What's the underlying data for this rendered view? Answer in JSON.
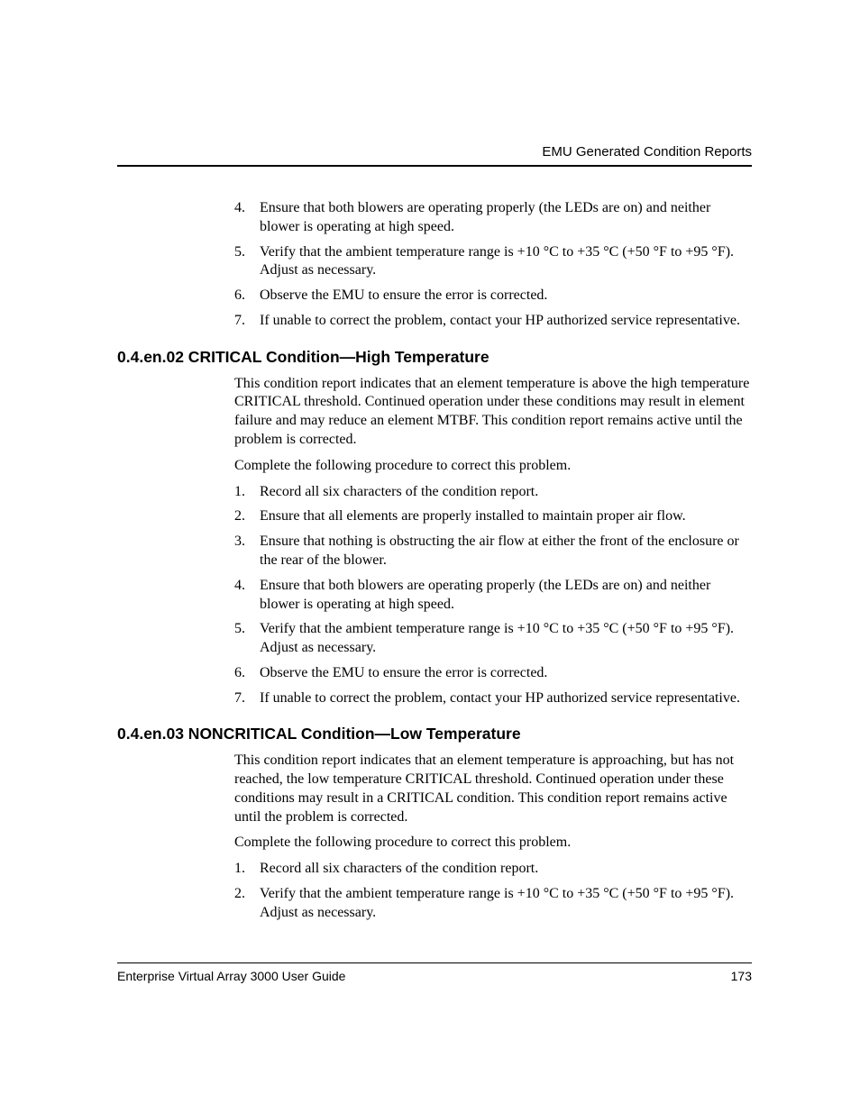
{
  "header": {
    "title": "EMU Generated Condition Reports"
  },
  "footer": {
    "doc_title": "Enterprise Virtual Array 3000 User Guide",
    "page_number": "173"
  },
  "top_list": {
    "items": [
      {
        "n": "4.",
        "t": "Ensure that both blowers are operating properly (the LEDs are on) and neither blower is operating at high speed."
      },
      {
        "n": "5.",
        "t": "Verify that the ambient temperature range is +10 °C to +35 °C (+50 °F to +95 °F). Adjust as necessary."
      },
      {
        "n": "6.",
        "t": "Observe the EMU to ensure the error is corrected."
      },
      {
        "n": "7.",
        "t": "If unable to correct the problem, contact your HP authorized service representative."
      }
    ]
  },
  "section1": {
    "heading": "0.4.en.02 CRITICAL Condition—High Temperature",
    "p1": "This condition report indicates that an element temperature is above the high temperature CRITICAL threshold. Continued operation under these conditions may result in element failure and may reduce an element MTBF. This condition report remains active until the problem is corrected.",
    "p2": "Complete the following procedure to correct this problem.",
    "items": [
      {
        "n": "1.",
        "t": "Record all six characters of the condition report."
      },
      {
        "n": "2.",
        "t": "Ensure that all elements are properly installed to maintain proper air flow."
      },
      {
        "n": "3.",
        "t": "Ensure that nothing is obstructing the air flow at either the front of the enclosure or the rear of the blower."
      },
      {
        "n": "4.",
        "t": "Ensure that both blowers are operating properly (the LEDs are on) and neither blower is operating at high speed."
      },
      {
        "n": "5.",
        "t": "Verify that the ambient temperature range is +10 °C to +35 °C (+50 °F to +95 °F). Adjust as necessary."
      },
      {
        "n": "6.",
        "t": "Observe the EMU to ensure the error is corrected."
      },
      {
        "n": "7.",
        "t": "If unable to correct the problem, contact your HP authorized service representative."
      }
    ]
  },
  "section2": {
    "heading": "0.4.en.03 NONCRITICAL Condition—Low Temperature",
    "p1": "This condition report indicates that an element temperature is approaching, but has not reached, the low temperature CRITICAL threshold. Continued operation under these conditions may result in a CRITICAL condition. This condition report remains active until the problem is corrected.",
    "p2": "Complete the following procedure to correct this problem.",
    "items": [
      {
        "n": "1.",
        "t": "Record all six characters of the condition report."
      },
      {
        "n": "2.",
        "t": "Verify that the ambient temperature range is +10 °C to +35 °C (+50 °F to +95 °F). Adjust as necessary."
      }
    ]
  }
}
